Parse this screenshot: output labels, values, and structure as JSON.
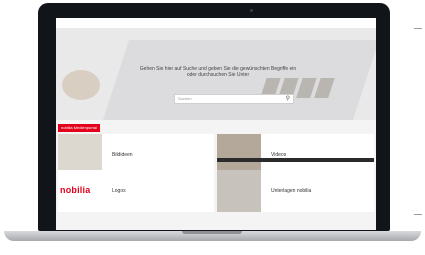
{
  "hero": {
    "text": "Gehen Sie hier auf Suche und geben Sie die gewünschten Begriffe ein oder durchsuchen Sie Unter",
    "search_placeholder": "Suchen"
  },
  "badge": {
    "label": "nobilia Medienportal"
  },
  "tiles": [
    {
      "label": "Bildideen"
    },
    {
      "label": "Videos"
    },
    {
      "label": "Logos"
    },
    {
      "label": "Unterlagen nobilia"
    }
  ],
  "logo": {
    "text": "nobilia"
  },
  "colors": {
    "brand": "#e2001a",
    "bezel": "#111418"
  }
}
